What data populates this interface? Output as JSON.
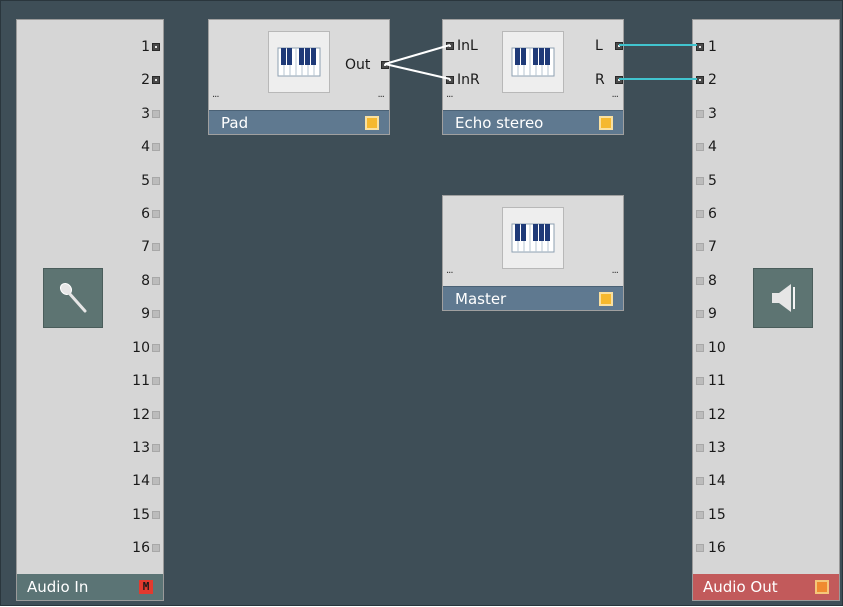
{
  "audio_in": {
    "title": "Audio In",
    "badge": "M",
    "icon": "microphone-icon",
    "ports": [
      "1",
      "2",
      "3",
      "4",
      "5",
      "6",
      "7",
      "8",
      "9",
      "10",
      "11",
      "12",
      "13",
      "14",
      "15",
      "16"
    ],
    "active_ports": [
      "1",
      "2"
    ]
  },
  "audio_out": {
    "title": "Audio Out",
    "icon": "speaker-icon",
    "ports": [
      "1",
      "2",
      "3",
      "4",
      "5",
      "6",
      "7",
      "8",
      "9",
      "10",
      "11",
      "12",
      "13",
      "14",
      "15",
      "16"
    ],
    "active_ports": [
      "1",
      "2"
    ]
  },
  "modules": {
    "pad": {
      "name": "Pad",
      "outputs": [
        "Out"
      ],
      "icon": "piano-keys-icon",
      "dots": "..."
    },
    "echo": {
      "name": "Echo stereo",
      "inputs": [
        "InL",
        "InR"
      ],
      "outputs": [
        "L",
        "R"
      ],
      "icon": "piano-keys-icon",
      "dots": "..."
    },
    "master": {
      "name": "Master",
      "icon": "piano-keys-icon",
      "dots": "..."
    }
  },
  "colors": {
    "canvas": "#3e4e57",
    "audio_in_footer": "#5b7475",
    "audio_out_footer": "#c25a5b",
    "module_footer": "#5f7990",
    "led_yellow": "#f5b82e",
    "wire_white": "#ffffff",
    "wire_cyan": "#41c4cf"
  }
}
